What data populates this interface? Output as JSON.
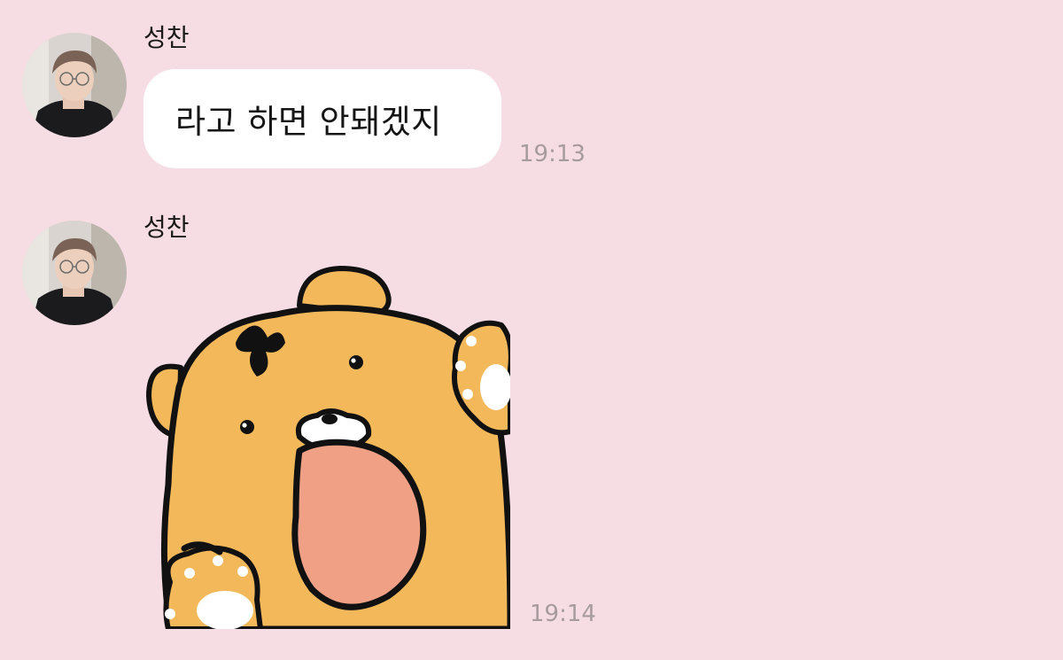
{
  "messages": [
    {
      "sender": "성찬",
      "avatar_icon": "profile-photo",
      "type": "text",
      "text": "라고 하면 안돼겠지",
      "time": "19:13"
    },
    {
      "sender": "성찬",
      "avatar_icon": "profile-photo",
      "type": "sticker",
      "sticker_icon": "tiger-sticker-roaring",
      "time": "19:14"
    }
  ],
  "colors": {
    "background": "#f6dce3",
    "bubble": "#ffffff",
    "timestamp": "#a69ca0",
    "sticker_body": "#f2b85a",
    "sticker_mouth": "#f0a085"
  }
}
